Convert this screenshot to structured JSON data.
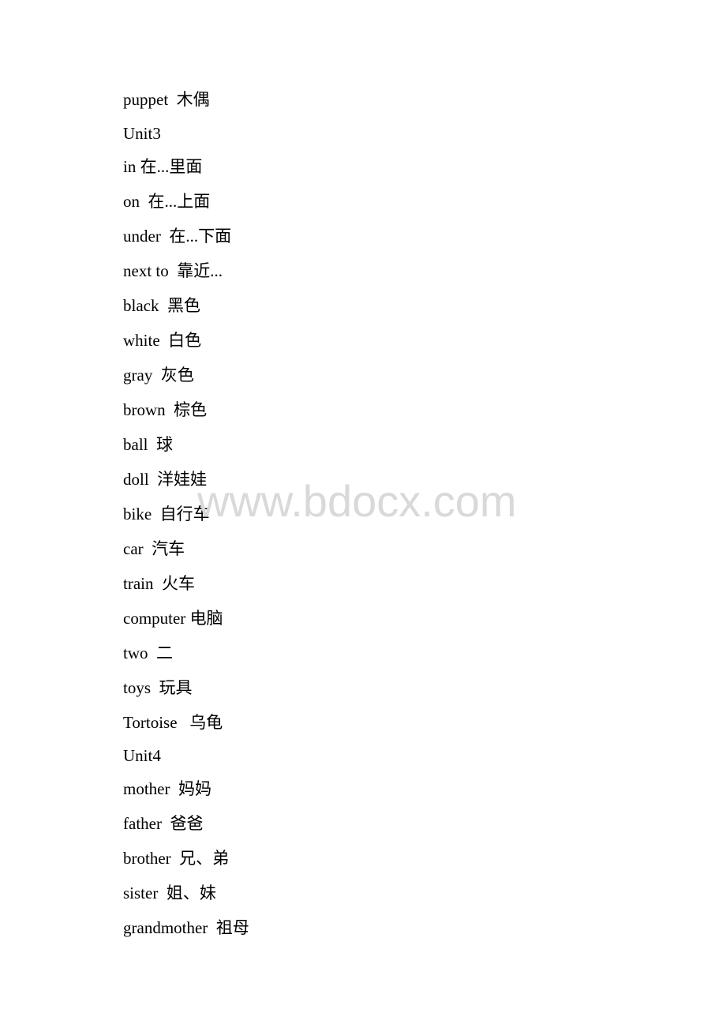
{
  "document": {
    "lines": [
      {
        "en": "puppet",
        "sep": "  ",
        "zh": "木偶"
      },
      {
        "en": "Unit3",
        "sep": "",
        "zh": ""
      },
      {
        "en": "in",
        "sep": " ",
        "zh": "在...里面"
      },
      {
        "en": "on",
        "sep": "  ",
        "zh": "在...上面"
      },
      {
        "en": "under",
        "sep": "  ",
        "zh": "在...下面"
      },
      {
        "en": "next to",
        "sep": "  ",
        "zh": "靠近..."
      },
      {
        "en": "black",
        "sep": "  ",
        "zh": "黑色"
      },
      {
        "en": "white",
        "sep": "  ",
        "zh": "白色"
      },
      {
        "en": "gray",
        "sep": "  ",
        "zh": "灰色"
      },
      {
        "en": "brown",
        "sep": "  ",
        "zh": "棕色"
      },
      {
        "en": "ball",
        "sep": "  ",
        "zh": "球"
      },
      {
        "en": "doll",
        "sep": "  ",
        "zh": "洋娃娃"
      },
      {
        "en": "bike",
        "sep": "  ",
        "zh": "自行车"
      },
      {
        "en": "car",
        "sep": "  ",
        "zh": "汽车"
      },
      {
        "en": "train",
        "sep": "  ",
        "zh": "火车"
      },
      {
        "en": "computer",
        "sep": " ",
        "zh": "电脑"
      },
      {
        "en": "two",
        "sep": "  ",
        "zh": "二"
      },
      {
        "en": "toys",
        "sep": "  ",
        "zh": "玩具"
      },
      {
        "en": "Tortoise",
        "sep": "   ",
        "zh": "乌龟"
      },
      {
        "en": "Unit4",
        "sep": "",
        "zh": ""
      },
      {
        "en": "mother",
        "sep": "  ",
        "zh": "妈妈"
      },
      {
        "en": "father",
        "sep": "  ",
        "zh": "爸爸"
      },
      {
        "en": "brother",
        "sep": "  ",
        "zh": "兄、弟"
      },
      {
        "en": "sister",
        "sep": "  ",
        "zh": "姐、妹"
      },
      {
        "en": "grandmother",
        "sep": "  ",
        "zh": "祖母"
      }
    ],
    "watermark": "www.bdocx.com"
  }
}
